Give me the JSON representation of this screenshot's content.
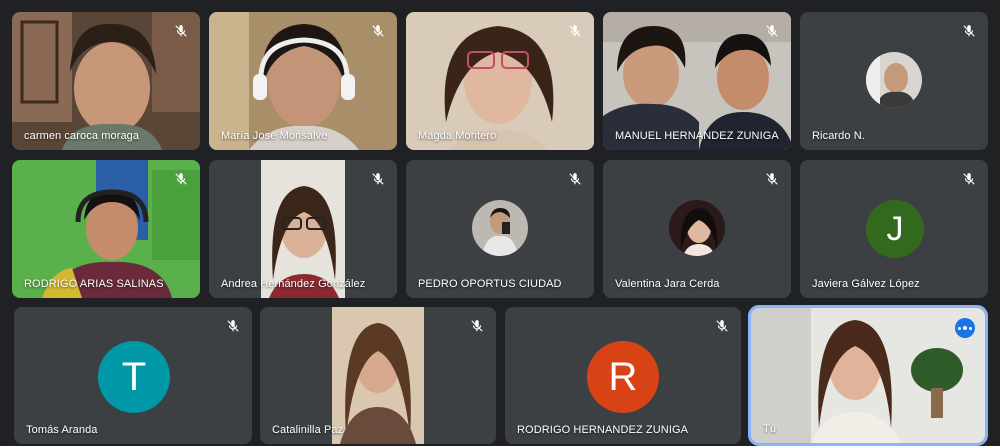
{
  "participants": [
    {
      "name": "carmen caroca moraga",
      "muted": true
    },
    {
      "name": "María José Monsalve",
      "muted": true
    },
    {
      "name": "Magda Montero",
      "muted": true
    },
    {
      "name": "MANUEL HERNANDEZ ZUNIGA",
      "muted": true
    },
    {
      "name": "Ricardo N.",
      "muted": true
    },
    {
      "name": "RODRIGO ARIAS SALINAS",
      "muted": true
    },
    {
      "name": "Andrea Hernández González",
      "muted": true
    },
    {
      "name": "PEDRO OPORTUS CIUDAD",
      "muted": true
    },
    {
      "name": "Valentina Jara Cerda",
      "muted": true
    },
    {
      "name": "Javiera Gálvez López",
      "muted": true,
      "initial": "J",
      "avatar_color": "#33691e"
    },
    {
      "name": "Tomás Aranda",
      "muted": true,
      "initial": "T",
      "avatar_color": "#0097a7"
    },
    {
      "name": "Catalinilla Paz",
      "muted": true
    },
    {
      "name": "RODRIGO HERNANDEZ ZUNIGA",
      "muted": true,
      "initial": "R",
      "avatar_color": "#d84315"
    },
    {
      "name": "Tú",
      "speaking": true
    }
  ],
  "icons": {
    "muted": "mic-off-icon",
    "speaking": "audio-level-icon"
  },
  "colors": {
    "background": "#202124",
    "tile": "#3c4043",
    "active_border": "#8ab4f8"
  }
}
